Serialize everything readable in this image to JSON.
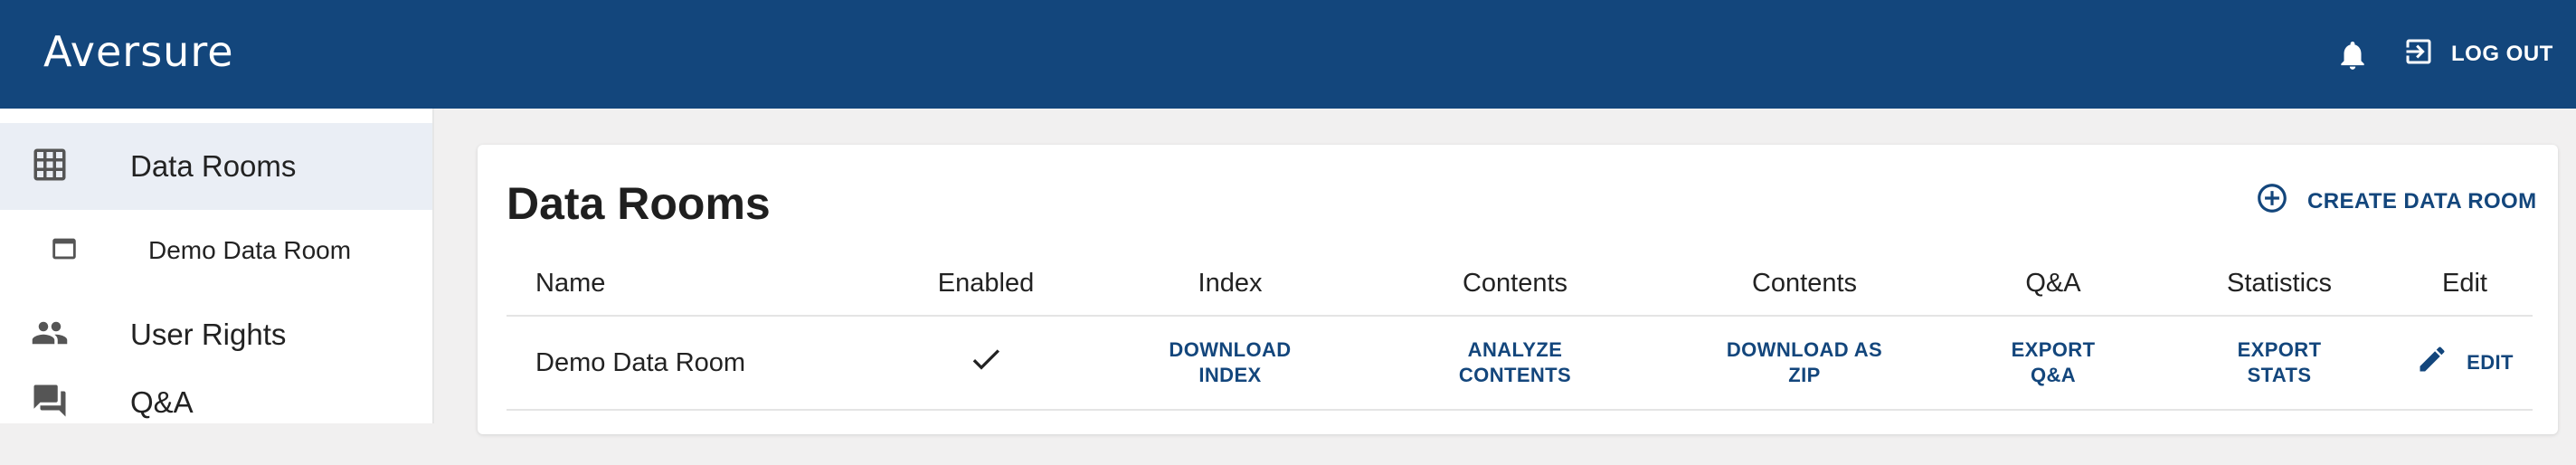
{
  "appbar": {
    "brand": "Aversure",
    "logout_label": "LOG OUT"
  },
  "sidebar": {
    "items": [
      {
        "label": "Data Rooms",
        "icon": "grid-icon",
        "active": true
      },
      {
        "label": "Demo Data Room",
        "icon": "window-icon",
        "active": false
      },
      {
        "label": "User Rights",
        "icon": "people-icon",
        "active": false
      },
      {
        "label": "Q&A",
        "icon": "chat-icon",
        "active": false
      }
    ]
  },
  "main": {
    "title": "Data Rooms",
    "create_label": "CREATE DATA ROOM",
    "columns": [
      "Name",
      "Enabled",
      "Index",
      "Contents",
      "Contents",
      "Q&A",
      "Statistics",
      "Edit"
    ],
    "rows": [
      {
        "name": "Demo Data Room",
        "enabled": "✓",
        "index_line1": "DOWNLOAD",
        "index_line2": "INDEX",
        "analyze_line1": "ANALYZE",
        "analyze_line2": "CONTENTS",
        "zip_line1": "DOWNLOAD AS",
        "zip_line2": "ZIP",
        "qa_line1": "EXPORT",
        "qa_line2": "Q&A",
        "stats_line1": "EXPORT",
        "stats_line2": "STATS",
        "edit_label": "EDIT"
      }
    ]
  },
  "colors": {
    "primary": "#13467c",
    "background": "#f1f0f0",
    "active_nav": "#eaeef5"
  }
}
